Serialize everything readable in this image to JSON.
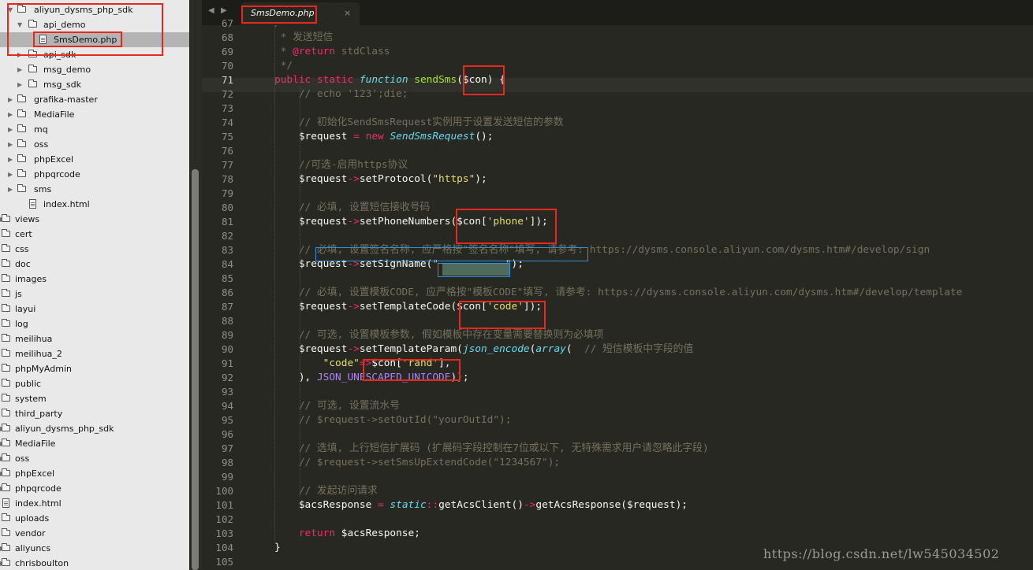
{
  "sidebar": {
    "items": [
      {
        "label": "aliyun_dysms_php_sdk",
        "type": "folder",
        "state": "open",
        "depth": 0
      },
      {
        "label": "api_demo",
        "type": "folder",
        "state": "open",
        "depth": 1
      },
      {
        "label": "SmsDemo.php",
        "type": "file",
        "depth": 2,
        "selected": true
      },
      {
        "label": "api_sdk",
        "type": "folder",
        "state": "closed",
        "depth": 1
      },
      {
        "label": "msg_demo",
        "type": "folder",
        "state": "closed",
        "depth": 1
      },
      {
        "label": "msg_sdk",
        "type": "folder",
        "state": "closed",
        "depth": 1
      },
      {
        "label": "grafika-master",
        "type": "folder",
        "state": "closed",
        "depth": 0
      },
      {
        "label": "MediaFile",
        "type": "folder",
        "state": "closed",
        "depth": 0
      },
      {
        "label": "mq",
        "type": "folder",
        "state": "closed",
        "depth": 0
      },
      {
        "label": "oss",
        "type": "folder",
        "state": "closed",
        "depth": 0
      },
      {
        "label": "phpExcel",
        "type": "folder",
        "state": "closed",
        "depth": 0
      },
      {
        "label": "phpqrcode",
        "type": "folder",
        "state": "closed",
        "depth": 0
      },
      {
        "label": "sms",
        "type": "folder",
        "state": "closed",
        "depth": 0
      },
      {
        "label": "index.html",
        "type": "file",
        "depth": 1
      },
      {
        "label": "views",
        "type": "folder",
        "state": "closed",
        "depth": -1
      },
      {
        "label": "cert",
        "type": "folder",
        "state": "none",
        "depth": -1
      },
      {
        "label": "css",
        "type": "folder",
        "state": "none",
        "depth": -1
      },
      {
        "label": "doc",
        "type": "folder",
        "state": "none",
        "depth": -1
      },
      {
        "label": "images",
        "type": "folder",
        "state": "none",
        "depth": -1
      },
      {
        "label": "js",
        "type": "folder",
        "state": "none",
        "depth": -1
      },
      {
        "label": "layui",
        "type": "folder",
        "state": "none",
        "depth": -1
      },
      {
        "label": "log",
        "type": "folder",
        "state": "none",
        "depth": -1
      },
      {
        "label": "meilihua",
        "type": "folder",
        "state": "none",
        "depth": -1
      },
      {
        "label": "meilihua_2",
        "type": "folder",
        "state": "none",
        "depth": -1
      },
      {
        "label": "phpMyAdmin",
        "type": "folder",
        "state": "none",
        "depth": -1
      },
      {
        "label": "public",
        "type": "folder",
        "state": "none",
        "depth": -1
      },
      {
        "label": "system",
        "type": "folder",
        "state": "none",
        "depth": -1
      },
      {
        "label": "third_party",
        "type": "folder",
        "state": "none",
        "depth": -1
      },
      {
        "label": "aliyun_dysms_php_sdk",
        "type": "folder",
        "state": "closed",
        "depth": -1
      },
      {
        "label": "MediaFile",
        "type": "folder",
        "state": "closed",
        "depth": -1
      },
      {
        "label": "oss",
        "type": "folder",
        "state": "closed",
        "depth": -1
      },
      {
        "label": "phpExcel",
        "type": "folder",
        "state": "closed",
        "depth": -1
      },
      {
        "label": "phpqrcode",
        "type": "folder",
        "state": "closed",
        "depth": -1
      },
      {
        "label": "index.html",
        "type": "file",
        "depth": -1
      },
      {
        "label": "uploads",
        "type": "folder",
        "state": "none",
        "depth": -1
      },
      {
        "label": "vendor",
        "type": "folder",
        "state": "none",
        "depth": -1
      },
      {
        "label": "aliyuncs",
        "type": "folder",
        "state": "closed",
        "depth": -1
      },
      {
        "label": "chrisboulton",
        "type": "folder",
        "state": "closed",
        "depth": -1
      }
    ]
  },
  "tabbar": {
    "back_icon": "◀",
    "forward_icon": "▶",
    "tab_title": "SmsDemo.php",
    "close_icon": "×"
  },
  "editor": {
    "current_line": 71,
    "lines": [
      {
        "n": "67",
        "tokens": [
          {
            "t": "/**",
            "c": "cmt"
          }
        ]
      },
      {
        "n": "68",
        "tokens": [
          {
            "t": " * 发送短信",
            "c": "cmt"
          }
        ]
      },
      {
        "n": "69",
        "tokens": [
          {
            "t": " * ",
            "c": "cmt"
          },
          {
            "t": "@return",
            "c": "kw"
          },
          {
            "t": " stdClass",
            "c": "cmt"
          }
        ]
      },
      {
        "n": "70",
        "tokens": [
          {
            "t": " */",
            "c": "cmt"
          }
        ]
      },
      {
        "n": "71",
        "tokens": [
          {
            "t": "public",
            "c": "kw"
          },
          {
            "t": " ",
            "c": "plain"
          },
          {
            "t": "static",
            "c": "kw"
          },
          {
            "t": " ",
            "c": "plain"
          },
          {
            "t": "function",
            "c": "stor"
          },
          {
            "t": " ",
            "c": "plain"
          },
          {
            "t": "sendSms",
            "c": "fn"
          },
          {
            "t": "($con) {",
            "c": "plain"
          }
        ]
      },
      {
        "n": "72",
        "tokens": [
          {
            "t": "    // echo '123';die;",
            "c": "cmt"
          }
        ]
      },
      {
        "n": "73",
        "tokens": []
      },
      {
        "n": "74",
        "tokens": [
          {
            "t": "    // 初始化SendSmsRequest实例用于设置发送短信的参数",
            "c": "cmt"
          }
        ]
      },
      {
        "n": "75",
        "tokens": [
          {
            "t": "    $request ",
            "c": "plain"
          },
          {
            "t": "=",
            "c": "kw"
          },
          {
            "t": " ",
            "c": "plain"
          },
          {
            "t": "new",
            "c": "kw"
          },
          {
            "t": " ",
            "c": "plain"
          },
          {
            "t": "SendSmsRequest",
            "c": "stor"
          },
          {
            "t": "();",
            "c": "plain"
          }
        ]
      },
      {
        "n": "76",
        "tokens": []
      },
      {
        "n": "77",
        "tokens": [
          {
            "t": "    //可选-启用https协议",
            "c": "cmt"
          }
        ]
      },
      {
        "n": "78",
        "tokens": [
          {
            "t": "    $request",
            "c": "plain"
          },
          {
            "t": "->",
            "c": "kw"
          },
          {
            "t": "setProtocol(",
            "c": "plain"
          },
          {
            "t": "\"https\"",
            "c": "str"
          },
          {
            "t": ");",
            "c": "plain"
          }
        ]
      },
      {
        "n": "79",
        "tokens": []
      },
      {
        "n": "80",
        "tokens": [
          {
            "t": "    // 必填, 设置短信接收号码",
            "c": "cmt"
          }
        ]
      },
      {
        "n": "81",
        "tokens": [
          {
            "t": "    $request",
            "c": "plain"
          },
          {
            "t": "->",
            "c": "kw"
          },
          {
            "t": "setPhoneNumbers($con[",
            "c": "plain"
          },
          {
            "t": "'phone'",
            "c": "str"
          },
          {
            "t": "]);",
            "c": "plain"
          }
        ]
      },
      {
        "n": "82",
        "tokens": []
      },
      {
        "n": "83",
        "tokens": [
          {
            "t": "    // 必填, 设置签名名称, 应严格按\"签名名称\"填写, 请参考: https://dysms.console.aliyun.com/dysms.htm#/develop/sign",
            "c": "cmt"
          }
        ]
      },
      {
        "n": "84",
        "tokens": [
          {
            "t": "    $request",
            "c": "plain"
          },
          {
            "t": "->",
            "c": "kw"
          },
          {
            "t": "setSignName(",
            "c": "plain"
          },
          {
            "t": "\"           \"",
            "c": "str"
          },
          {
            "t": ");",
            "c": "plain"
          }
        ]
      },
      {
        "n": "85",
        "tokens": []
      },
      {
        "n": "86",
        "tokens": [
          {
            "t": "    // 必填, 设置模板CODE, 应严格按\"模板CODE\"填写, 请参考: https://dysms.console.aliyun.com/dysms.htm#/develop/template",
            "c": "cmt"
          }
        ]
      },
      {
        "n": "87",
        "tokens": [
          {
            "t": "    $request",
            "c": "plain"
          },
          {
            "t": "->",
            "c": "kw"
          },
          {
            "t": "setTemplateCode($con[",
            "c": "plain"
          },
          {
            "t": "'code'",
            "c": "str"
          },
          {
            "t": "]);",
            "c": "plain"
          }
        ]
      },
      {
        "n": "88",
        "tokens": []
      },
      {
        "n": "89",
        "tokens": [
          {
            "t": "    // 可选, 设置模板参数, 假如模板中存在变量需要替换则为必填项",
            "c": "cmt"
          }
        ]
      },
      {
        "n": "90",
        "tokens": [
          {
            "t": "    $request",
            "c": "plain"
          },
          {
            "t": "->",
            "c": "kw"
          },
          {
            "t": "setTemplateParam(",
            "c": "plain"
          },
          {
            "t": "json_encode",
            "c": "stor"
          },
          {
            "t": "(",
            "c": "plain"
          },
          {
            "t": "array",
            "c": "stor"
          },
          {
            "t": "(  ",
            "c": "plain"
          },
          {
            "t": "// 短信模板中字段的值",
            "c": "cmt"
          }
        ]
      },
      {
        "n": "91",
        "tokens": [
          {
            "t": "        ",
            "c": "plain"
          },
          {
            "t": "\"code\"",
            "c": "str"
          },
          {
            "t": "=>",
            "c": "kw"
          },
          {
            "t": "$con[",
            "c": "plain"
          },
          {
            "t": "'rand'",
            "c": "str"
          },
          {
            "t": "],",
            "c": "plain"
          }
        ]
      },
      {
        "n": "92",
        "tokens": [
          {
            "t": "    ), ",
            "c": "plain"
          },
          {
            "t": "JSON_UNESCAPED_UNICODE",
            "c": "cst"
          },
          {
            "t": "));",
            "c": "plain"
          }
        ]
      },
      {
        "n": "93",
        "tokens": []
      },
      {
        "n": "94",
        "tokens": [
          {
            "t": "    // 可选, 设置流水号",
            "c": "cmt"
          }
        ]
      },
      {
        "n": "95",
        "tokens": [
          {
            "t": "    // $request->setOutId(\"yourOutId\");",
            "c": "cmt"
          }
        ]
      },
      {
        "n": "96",
        "tokens": []
      },
      {
        "n": "97",
        "tokens": [
          {
            "t": "    // 选填, 上行短信扩展码 (扩展码字段控制在7位或以下, 无特殊需求用户请忽略此字段)",
            "c": "cmt"
          }
        ]
      },
      {
        "n": "98",
        "tokens": [
          {
            "t": "    // $request->setSmsUpExtendCode(\"1234567\");",
            "c": "cmt"
          }
        ]
      },
      {
        "n": "99",
        "tokens": []
      },
      {
        "n": "100",
        "tokens": [
          {
            "t": "    // 发起访问请求",
            "c": "cmt"
          }
        ]
      },
      {
        "n": "101",
        "tokens": [
          {
            "t": "    $acsResponse ",
            "c": "plain"
          },
          {
            "t": "=",
            "c": "kw"
          },
          {
            "t": " ",
            "c": "plain"
          },
          {
            "t": "static",
            "c": "stor"
          },
          {
            "t": "::",
            "c": "kw"
          },
          {
            "t": "getAcsClient()",
            "c": "plain"
          },
          {
            "t": "->",
            "c": "kw"
          },
          {
            "t": "getAcsResponse($request);",
            "c": "plain"
          }
        ]
      },
      {
        "n": "102",
        "tokens": []
      },
      {
        "n": "103",
        "tokens": [
          {
            "t": "    ",
            "c": "plain"
          },
          {
            "t": "return",
            "c": "kw"
          },
          {
            "t": " $acsResponse;",
            "c": "plain"
          }
        ]
      },
      {
        "n": "104",
        "tokens": [
          {
            "t": "}",
            "c": "plain"
          }
        ]
      },
      {
        "n": "105",
        "tokens": []
      }
    ]
  },
  "watermark": "https://blog.csdn.net/lw545034502",
  "colors": {
    "editor_bg": "#272822",
    "comment": "#75715e",
    "keyword": "#f92672",
    "storage": "#66d9ef",
    "function": "#a6e22e",
    "string": "#e6db74",
    "constant": "#ae81ff",
    "annotation_red": "#e8281c",
    "annotation_blue": "#2f8fd8"
  }
}
